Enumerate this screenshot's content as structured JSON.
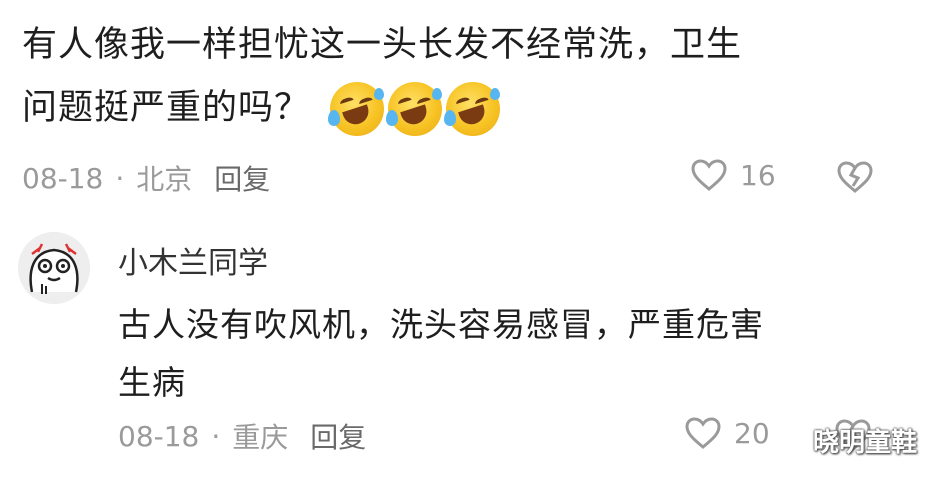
{
  "comment": {
    "text_line1": "有人像我一样担忧这一头长发不经常洗，卫生",
    "text_line2": "问题挺严重的吗？",
    "emojis": [
      "rolling-laughing-emoji",
      "rolling-laughing-emoji",
      "rolling-laughing-emoji"
    ],
    "date": "08-18",
    "separator": "·",
    "location": "北京",
    "reply_label": "回复",
    "likes": "16"
  },
  "reply": {
    "username": "小木兰同学",
    "text_line1": "古人没有吹风机，洗头容易感冒，严重危害",
    "text_line2": "生病",
    "date": "08-18",
    "separator": "·",
    "location": "重庆",
    "reply_label": "回复",
    "likes": "20"
  },
  "watermark": "晓明童鞋",
  "colors": {
    "text": "#1e1e1e",
    "meta": "#9a9a9a",
    "reply_link": "#6a6a6a",
    "emoji_face": "#f7c324"
  }
}
